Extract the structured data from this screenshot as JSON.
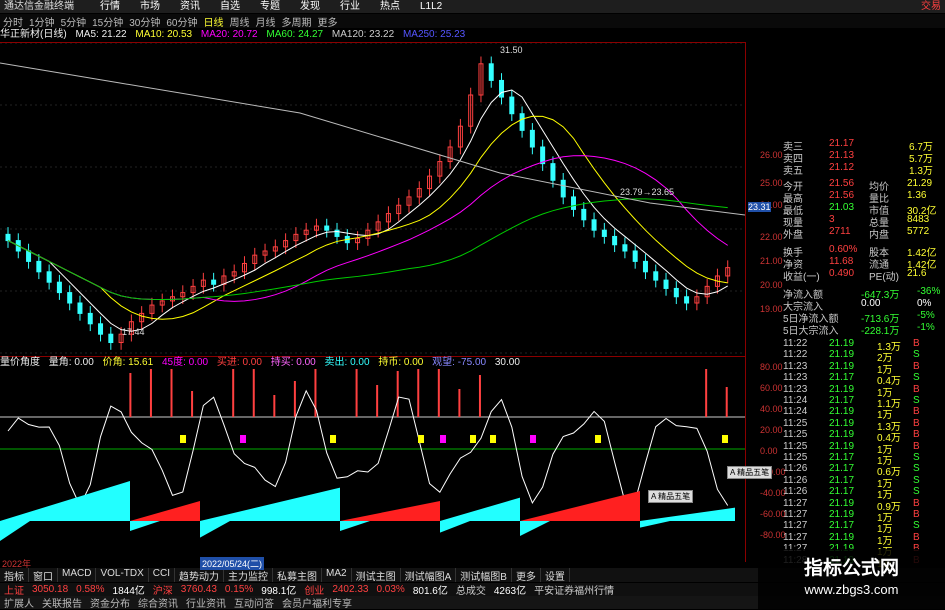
{
  "app": {
    "title": "通达信金融终端",
    "menu": [
      "行情",
      "市场",
      "资讯",
      "自选",
      "专题",
      "发现",
      "行业",
      "热点",
      "L1L2"
    ],
    "top_right": "交易"
  },
  "periods": [
    "分时",
    "1分钟",
    "5分钟",
    "15分钟",
    "30分钟",
    "60分钟",
    "日线",
    "周线",
    "月线",
    "多周期",
    "更多"
  ],
  "selected_period": "日线",
  "ma_bar": {
    "stock": "华正新材(日线)",
    "ma5": "MA5: 21.22",
    "ma10": "MA10: 20.53",
    "ma20": "MA20: 20.72",
    "ma60": "MA60: 24.27",
    "ma120": "MA120: 23.22",
    "ma250": "MA250: 25.23"
  },
  "chart_annotations": {
    "high": "31.50",
    "low": "17.44",
    "mid": "23.79→23.65",
    "price_tag": "23.31"
  },
  "price_axis": [
    "26.00",
    "25.00",
    "24.00",
    "23.31",
    "22.00",
    "21.00",
    "20.00",
    "19.00"
  ],
  "ind_axis": [
    "80.00",
    "60.00",
    "40.00",
    "20.00",
    "0.00",
    "-20.00",
    "-40.00",
    "-60.00",
    "-80.00"
  ],
  "ind_bar": {
    "name": "量价角度",
    "item1": "量角: 0.00",
    "item2": "价角: 15.61",
    "item3": "45度: 0.00",
    "item4": "买进: 0.00",
    "item5": "持买: 0.00",
    "item6": "卖出: 0.00",
    "item7": "持币: 0.00",
    "item8": "观望: -75.00",
    "item9": "30.00"
  },
  "date_marks": [
    "2022年",
    "2022/05/24(二)"
  ],
  "tooltips": [
    "A 精品五笔",
    "A 精品五笔"
  ],
  "quote": [
    {
      "k": "卖三",
      "v": "21.17",
      "r": "6.7万"
    },
    {
      "k": "卖四",
      "v": "21.13",
      "r": "5.7万"
    },
    {
      "k": "卖五",
      "v": "21.12",
      "r": "1.3万"
    },
    {
      "k": "今开",
      "v": "21.56",
      "k2": "均价",
      "v2": "21.29"
    },
    {
      "k": "最高",
      "v": "21.56",
      "k2": "量比",
      "v2": "1.36"
    },
    {
      "k": "最低",
      "v": "21.03",
      "k2": "市值",
      "v2": "30.2亿"
    },
    {
      "k": "现量",
      "v": "3",
      "k2": "总量",
      "v2": "8483"
    },
    {
      "k": "外盘",
      "v": "2711",
      "k2": "内盘",
      "v2": "5772"
    },
    {
      "k": "换手",
      "v": "0.60%",
      "k2": "股本",
      "v2": "1.42亿"
    },
    {
      "k": "净资",
      "v": "11.68",
      "k2": "流通",
      "v2": "1.42亿"
    },
    {
      "k": "收益(一)",
      "v": "0.490",
      "k2": "PE(动)",
      "v2": "21.6"
    }
  ],
  "flows": [
    {
      "k": "净流入额",
      "v": "-647.3万",
      "r": "-36%"
    },
    {
      "k": "大宗流入",
      "v": "0.00",
      "r": "0%"
    },
    {
      "k": "5日净流入额",
      "v": "-713.6万",
      "r": "-5%"
    },
    {
      "k": "5日大宗流入",
      "v": "-228.1万",
      "r": "-1%"
    }
  ],
  "ticks": [
    {
      "t": "11:22",
      "p": "21.19",
      "v": "1.3万",
      "s": "B"
    },
    {
      "t": "11:22",
      "p": "21.19",
      "v": "2万",
      "s": "S"
    },
    {
      "t": "11:23",
      "p": "21.19",
      "v": "1万",
      "s": "B"
    },
    {
      "t": "11:23",
      "p": "21.17",
      "v": "0.4万",
      "s": "S"
    },
    {
      "t": "11:23",
      "p": "21.19",
      "v": "1万",
      "s": "B"
    },
    {
      "t": "11:24",
      "p": "21.17",
      "v": "1.1万",
      "s": "S"
    },
    {
      "t": "11:24",
      "p": "21.19",
      "v": "1万",
      "s": "B"
    },
    {
      "t": "11:25",
      "p": "21.19",
      "v": "1.3万",
      "s": "B"
    },
    {
      "t": "11:25",
      "p": "21.19",
      "v": "0.4万",
      "s": "B"
    },
    {
      "t": "11:25",
      "p": "21.19",
      "v": "1万",
      "s": "B"
    },
    {
      "t": "11:25",
      "p": "21.17",
      "v": "1万",
      "s": "S"
    },
    {
      "t": "11:26",
      "p": "21.17",
      "v": "0.6万",
      "s": "S"
    },
    {
      "t": "11:26",
      "p": "21.17",
      "v": "1万",
      "s": "S"
    },
    {
      "t": "11:26",
      "p": "21.17",
      "v": "1万",
      "s": "S"
    },
    {
      "t": "11:27",
      "p": "21.19",
      "v": "0.9万",
      "s": "B"
    },
    {
      "t": "11:27",
      "p": "21.19",
      "v": "1万",
      "s": "B"
    },
    {
      "t": "11:27",
      "p": "21.17",
      "v": "1万",
      "s": "S"
    },
    {
      "t": "11:27",
      "p": "21.19",
      "v": "1万",
      "s": "B"
    },
    {
      "t": "11:27",
      "p": "21.19",
      "v": "1万",
      "s": "B"
    },
    {
      "t": "11:28",
      "p": "21.19",
      "v": "1万",
      "s": "B"
    }
  ],
  "bottom_tabs": [
    "指标",
    "窗口",
    "MACD",
    "VOL-TDX",
    "CCI",
    "趋势动力",
    "主力监控",
    "私募主图",
    "MA2",
    "测试主图",
    "测试幅图A",
    "测试幅图B",
    "更多",
    "设置"
  ],
  "status": [
    {
      "name": "上证",
      "price": "3050.18",
      "pct": "0.58%",
      "amt": "1844亿"
    },
    {
      "name": "沪深",
      "price": "3760.43",
      "pct": "0.15%",
      "amt": "998.1亿"
    },
    {
      "name": "创业",
      "price": "2402.33",
      "pct": "0.03%",
      "amt": "801.6亿"
    }
  ],
  "status_extra": {
    "label": "总成交",
    "value": "4263亿",
    "broker": "平安证券福州行情"
  },
  "footer": [
    "扩展人",
    "关联报告",
    "资金分布",
    "综合资讯",
    "行业资讯",
    "互动问答",
    "会员户福利专享"
  ],
  "watermark": {
    "title": "指标公式网",
    "url": "www.zbgs3.com"
  },
  "colors": {
    "up": "#ff4040",
    "down": "#00ffff",
    "ma5": "#ffffff",
    "ma10": "#ffff00",
    "ma20": "#ff00ff",
    "ma60": "#00ff00",
    "ma120": "#c0c0c0",
    "bg": "#000000"
  }
}
